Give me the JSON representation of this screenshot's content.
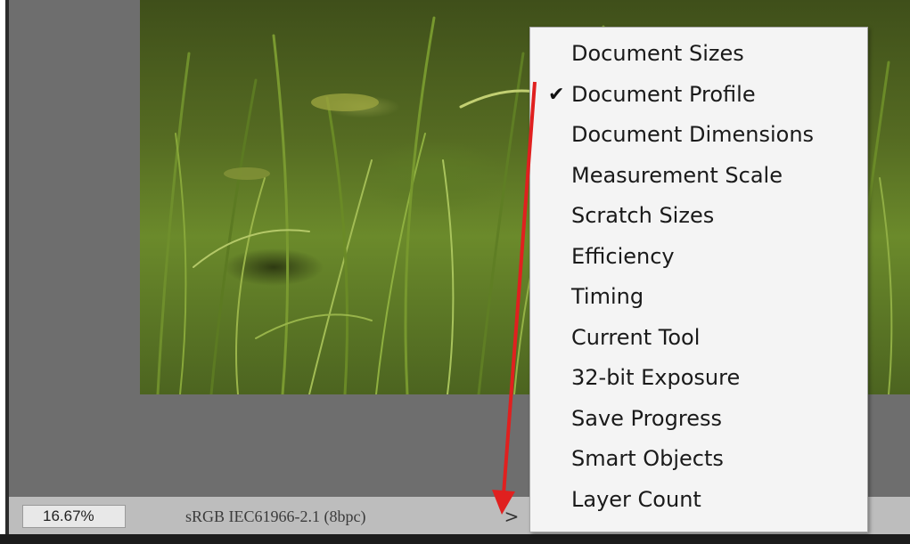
{
  "status_bar": {
    "zoom": "16.67%",
    "document_info": "sRGB IEC61966-2.1 (8bpc)",
    "menu_toggle": ">"
  },
  "menu": {
    "items": [
      {
        "label": "Document Sizes",
        "checked": false
      },
      {
        "label": "Document Profile",
        "checked": true
      },
      {
        "label": "Document Dimensions",
        "checked": false
      },
      {
        "label": "Measurement Scale",
        "checked": false
      },
      {
        "label": "Scratch Sizes",
        "checked": false
      },
      {
        "label": "Efficiency",
        "checked": false
      },
      {
        "label": "Timing",
        "checked": false
      },
      {
        "label": "Current Tool",
        "checked": false
      },
      {
        "label": "32-bit Exposure",
        "checked": false
      },
      {
        "label": "Save Progress",
        "checked": false
      },
      {
        "label": "Smart Objects",
        "checked": false
      },
      {
        "label": "Layer Count",
        "checked": false
      }
    ],
    "check_glyph": "✔"
  },
  "colors": {
    "workspace": "#6e6e6e",
    "menu_bg": "#f4f4f4",
    "annotation_arrow": "#e0201f"
  }
}
